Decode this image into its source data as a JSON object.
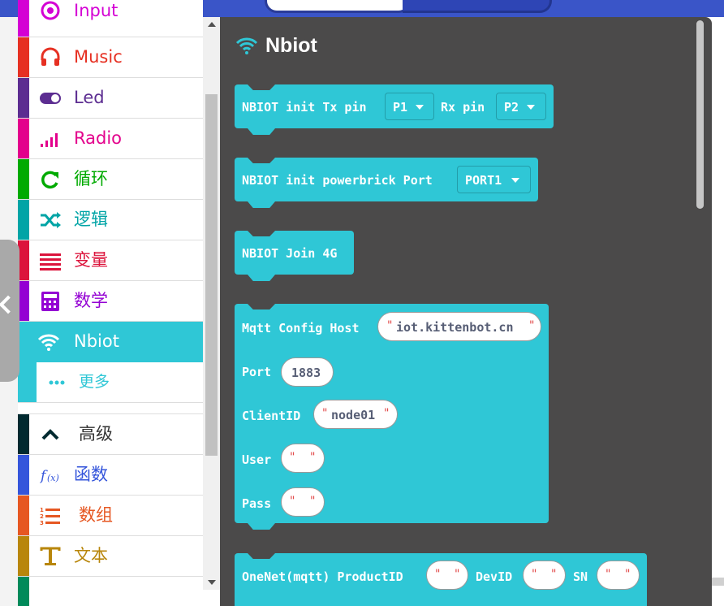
{
  "colors": {
    "input": "#d400d4",
    "music": "#e63022",
    "led": "#5c2d91",
    "radio": "#e3008c",
    "loops": "#00aa00",
    "logic": "#00a4a6",
    "variables": "#dc143c",
    "math": "#9400d3",
    "nbiot": "#2fc7d6",
    "advanced": "#012a30",
    "functions": "#3455db",
    "arrays": "#e65722",
    "text": "#b8860b",
    "block": "#2fc7d6",
    "flyout_bg": "#4b4a4a",
    "topbar": "#3a55c8"
  },
  "categories": [
    {
      "label": "Input",
      "icon": "target-icon"
    },
    {
      "label": "Music",
      "icon": "headphones-icon"
    },
    {
      "label": "Led",
      "icon": "toggle-icon"
    },
    {
      "label": "Radio",
      "icon": "signal-bars-icon"
    },
    {
      "label": "循环",
      "icon": "refresh-icon"
    },
    {
      "label": "逻辑",
      "icon": "shuffle-icon"
    },
    {
      "label": "变量",
      "icon": "list-lines-icon"
    },
    {
      "label": "数学",
      "icon": "calculator-icon"
    },
    {
      "label": "Nbiot",
      "icon": "wifi-icon",
      "selected": true
    },
    {
      "label": "更多",
      "icon": "more-dots-icon"
    },
    {
      "label": "高级",
      "icon": "chevron-up-icon"
    },
    {
      "label": "函数",
      "icon": "function-icon"
    },
    {
      "label": "数组",
      "icon": "numbered-list-icon"
    },
    {
      "label": "文本",
      "icon": "text-icon"
    }
  ],
  "flyout": {
    "title": "Nbiot",
    "blocks": {
      "init": {
        "label1": "NBIOT init Tx pin",
        "tx_value": "P1",
        "label2": "Rx pin",
        "rx_value": "P2"
      },
      "powerbrick": {
        "label": "NBIOT init powerbrick Port",
        "port_value": "PORT1"
      },
      "join": {
        "label": "NBIOT Join 4G"
      },
      "mqtt": {
        "host_label": "Mqtt Config Host",
        "host_value": "iot.kittenbot.cn",
        "port_label": "Port",
        "port_value": "1883",
        "clientid_label": "ClientID",
        "clientid_value": "node01",
        "user_label": "User",
        "user_value": "",
        "pass_label": "Pass",
        "pass_value": ""
      },
      "onenet": {
        "label1": "OneNet(mqtt) ProductID",
        "product_value": "",
        "label2": "DevID",
        "dev_value": "",
        "label3": "SN",
        "sn_value": ""
      }
    }
  }
}
